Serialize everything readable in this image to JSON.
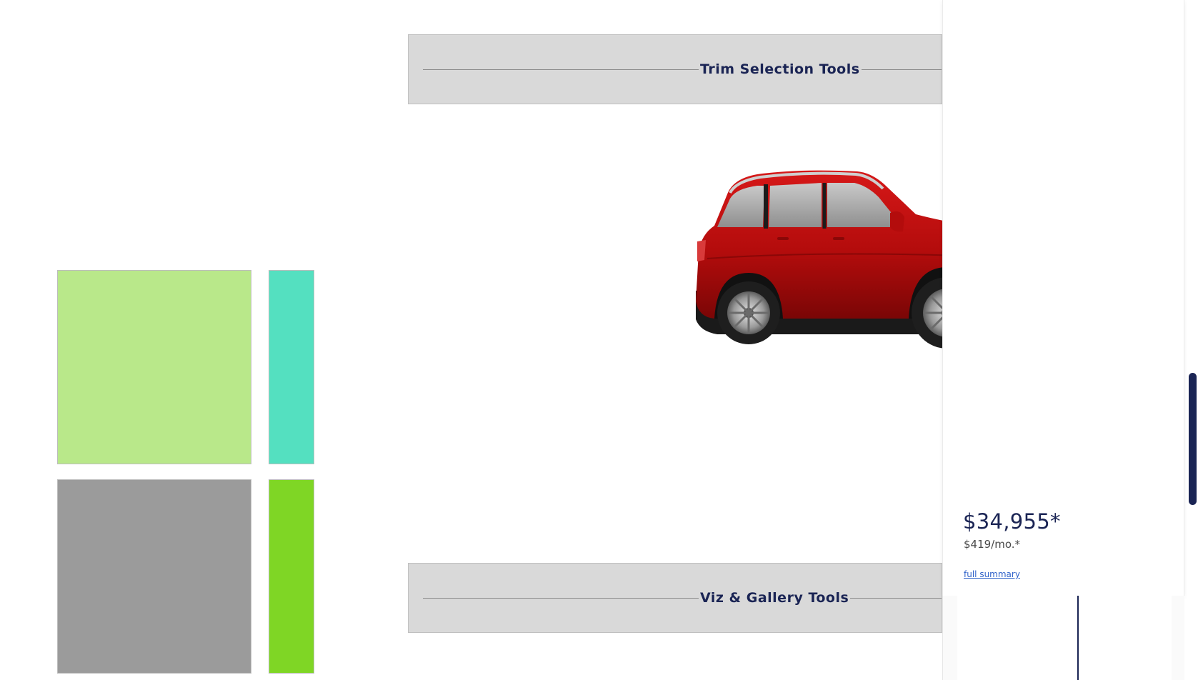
{
  "sections": {
    "trim_title": "Trim Selection Tools",
    "viz_title": "Viz & Gallery Tools"
  },
  "summary": {
    "price": "$34,955*",
    "monthly": "$419/mo.*",
    "link_label": "full summary"
  },
  "vehicle": {
    "type": "SUV",
    "color": "#b80c0c"
  },
  "swatches": {
    "colors": [
      "#b9e88a",
      "#54e0c0",
      "#9b9b9b",
      "#7fd625"
    ]
  },
  "colors": {
    "accent": "#1a2454",
    "link": "#2f62c9",
    "bar_background": "#d9d9d9"
  }
}
